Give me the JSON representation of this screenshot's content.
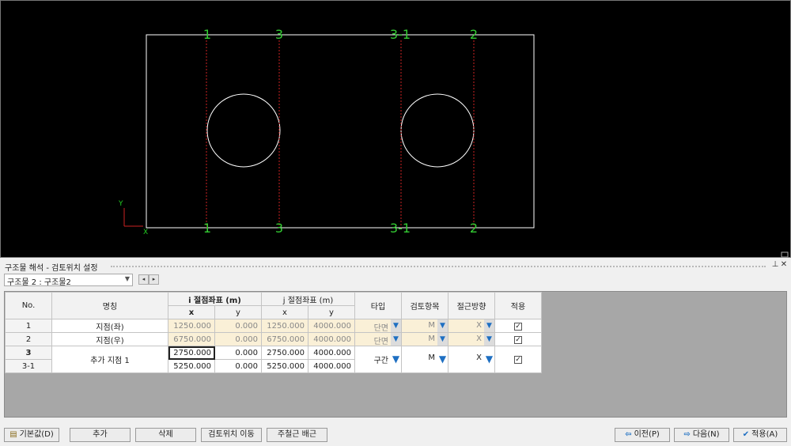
{
  "canvas": {
    "section_labels_top": [
      "1",
      "3",
      "3-1",
      "2"
    ],
    "section_labels_bottom": [
      "1",
      "3",
      "3-1",
      "2"
    ],
    "axis_y": "Y",
    "axis_x": "X",
    "colors": {
      "background": "#000000",
      "outline": "#ffffff",
      "section_line": "#cc2222",
      "label": "#33cc33"
    }
  },
  "panel": {
    "title": "구조물 해석 - 검토위치 설정",
    "pin_icon": "pin-icon",
    "close_icon": "close-icon",
    "structure_select": "구조물 2 : 구조물2",
    "prev_icon": "◂",
    "next_icon": "▸"
  },
  "grid": {
    "headers": {
      "no": "No.",
      "name": "명칭",
      "i_coord": "i 절점좌표 (m)",
      "j_coord": "j 절점좌표 (m)",
      "x": "x",
      "y": "y",
      "type": "타입",
      "check_item": "검토항목",
      "approach": "절근방향",
      "apply": "적용"
    },
    "rows": [
      {
        "no": "1",
        "name": "지점(좌)",
        "ix": "1250.000",
        "iy": "0.000",
        "jx": "1250.000",
        "jy": "4000.000",
        "type": "단면",
        "check": "M",
        "dir": "X",
        "apply": true
      },
      {
        "no": "2",
        "name": "지점(우)",
        "ix": "6750.000",
        "iy": "0.000",
        "jx": "6750.000",
        "jy": "4000.000",
        "type": "단면",
        "check": "M",
        "dir": "X",
        "apply": true
      }
    ],
    "group": {
      "no1": "3",
      "no2": "3-1",
      "name": "추가 지점 1",
      "ix1": "2750.000",
      "iy1": "0.000",
      "jx1": "2750.000",
      "jy1": "4000.000",
      "ix2": "5250.000",
      "iy2": "0.000",
      "jx2": "5250.000",
      "jy2": "4000.000",
      "type": "구간",
      "check": "M",
      "dir": "X",
      "apply": true
    },
    "dropdown_icon": "▼",
    "check_mark": "✓"
  },
  "buttons": {
    "default": "기본값(D)",
    "add": "추가",
    "delete": "삭제",
    "move": "검토위치 이동",
    "rebar": "주철근 배근",
    "prev": "이전(P)",
    "next": "다음(N)",
    "apply": "적용(A)"
  }
}
